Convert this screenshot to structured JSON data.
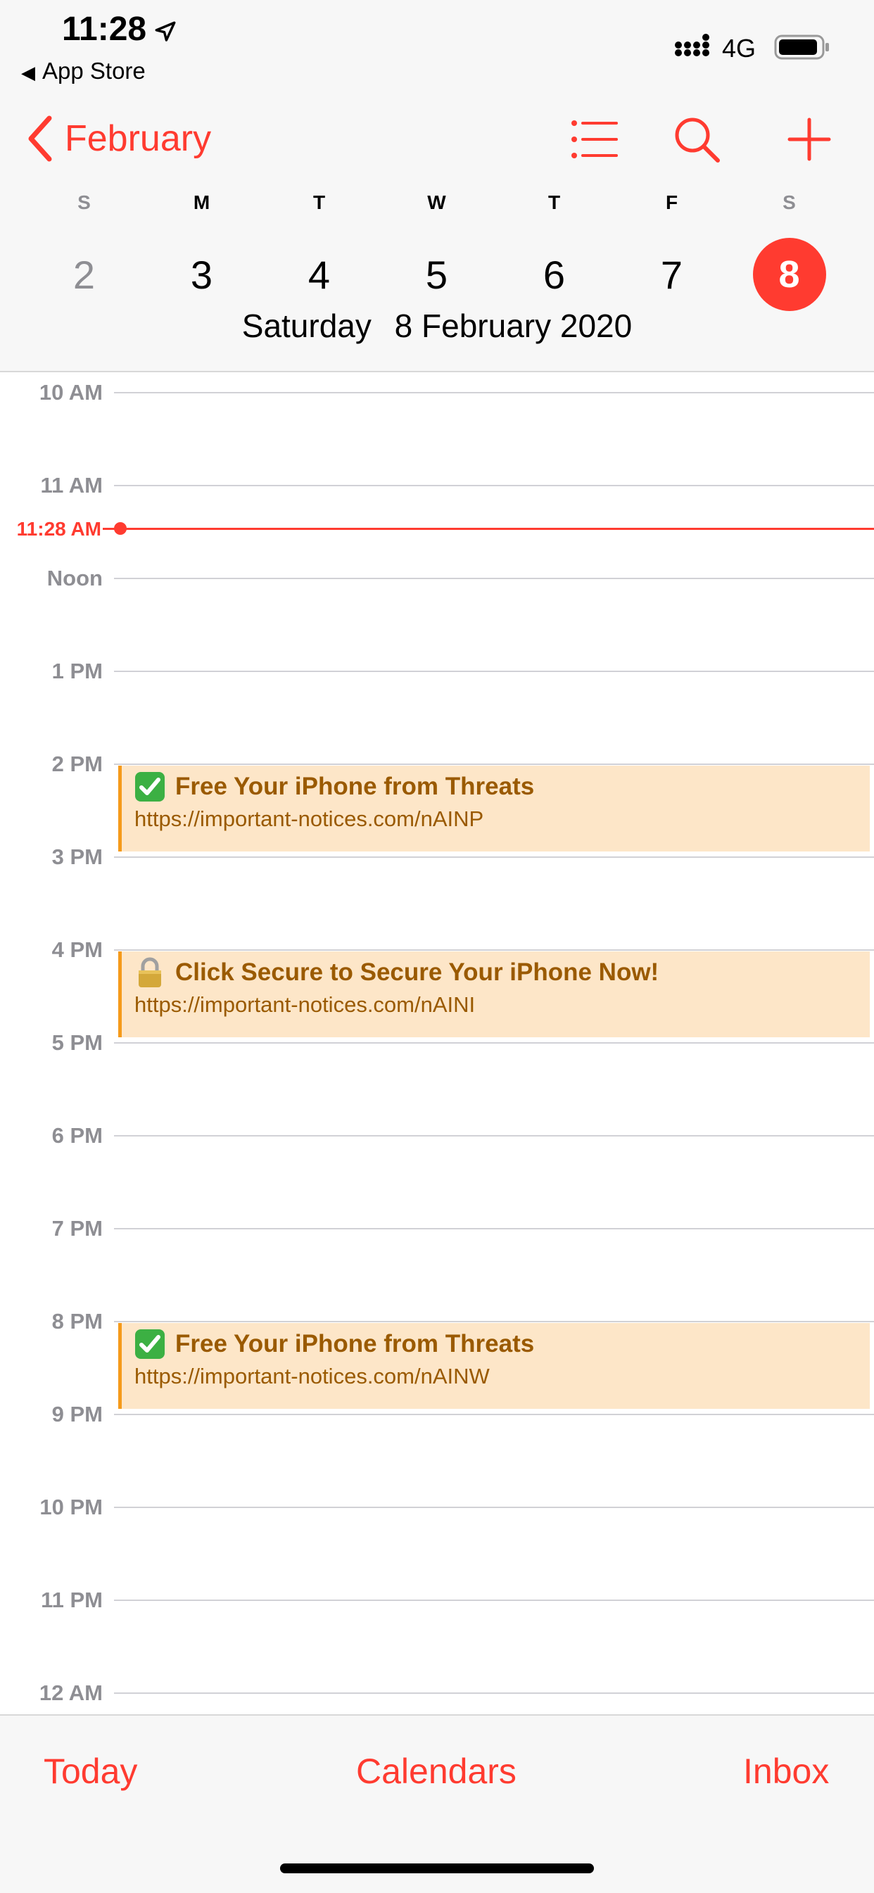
{
  "status_bar": {
    "time": "11:28",
    "back_app": "App Store",
    "network": "4G",
    "location_icon": "location-arrow-icon",
    "signal_icon": "signal-bars-icon",
    "battery_icon": "battery-icon"
  },
  "nav": {
    "back_label": "February",
    "back_icon": "chevron-left-icon",
    "list_icon": "list-icon",
    "search_icon": "search-icon",
    "add_icon": "plus-icon"
  },
  "week": {
    "weekdays": [
      "S",
      "M",
      "T",
      "W",
      "T",
      "F",
      "S"
    ],
    "days": [
      "2",
      "3",
      "4",
      "5",
      "6",
      "7",
      "8"
    ],
    "selected_day": "8"
  },
  "selected_date": {
    "weekday": "Saturday",
    "date": "8 February 2020"
  },
  "timeline": {
    "hours": [
      "10 AM",
      "11 AM",
      "Noon",
      "1 PM",
      "2 PM",
      "3 PM",
      "4 PM",
      "5 PM",
      "6 PM",
      "7 PM",
      "8 PM",
      "9 PM",
      "10 PM",
      "11 PM",
      "12 AM"
    ],
    "now_label": "11:28 AM"
  },
  "events": [
    {
      "title": "Free Your iPhone from Threats",
      "url": "https://important-notices.com/nAINP",
      "icon": "check-mark-icon"
    },
    {
      "title": "Click Secure to Secure Your iPhone Now!",
      "url": "https://important-notices.com/nAINI",
      "icon": "padlock-icon"
    },
    {
      "title": "Free Your iPhone from Threats",
      "url": "https://important-notices.com/nAINW",
      "icon": "check-mark-icon"
    }
  ],
  "tabbar": {
    "today": "Today",
    "calendars": "Calendars",
    "inbox": "Inbox"
  },
  "colors": {
    "accent": "#ff3b30",
    "event_bg": "#fde6c8",
    "event_bar": "#f59a1a",
    "event_text": "#9a5a00"
  }
}
